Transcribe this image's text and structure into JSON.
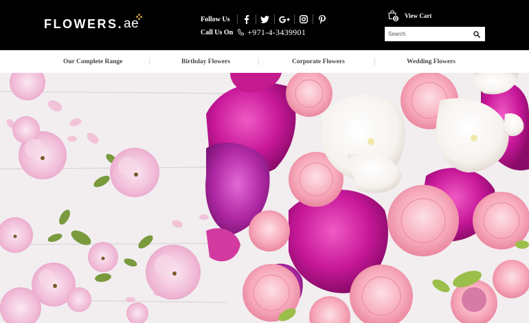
{
  "logo": {
    "main": "FLOWERS.",
    "ext": "ae"
  },
  "header": {
    "follow_label": "Follow Us",
    "call_label": "Call Us On",
    "phone": "+971-4-3439901",
    "social": [
      "facebook-icon",
      "twitter-icon",
      "google-plus-icon",
      "instagram-icon",
      "pinterest-icon"
    ]
  },
  "cart": {
    "count": "0",
    "label": "View Cart"
  },
  "search": {
    "placeholder": "Search",
    "value": ""
  },
  "nav": {
    "items": [
      {
        "label": "Our Complete Range"
      },
      {
        "label": "Birthday Flowers"
      },
      {
        "label": "Corporate Flowers"
      },
      {
        "label": "Wedding Flowers"
      }
    ]
  },
  "hero": {
    "image": "pink-and-white-flowers-on-wooden-table"
  },
  "colors": {
    "header_bg": "#000000",
    "logo_accent": "#c89a3c",
    "nav_text": "#444444"
  }
}
